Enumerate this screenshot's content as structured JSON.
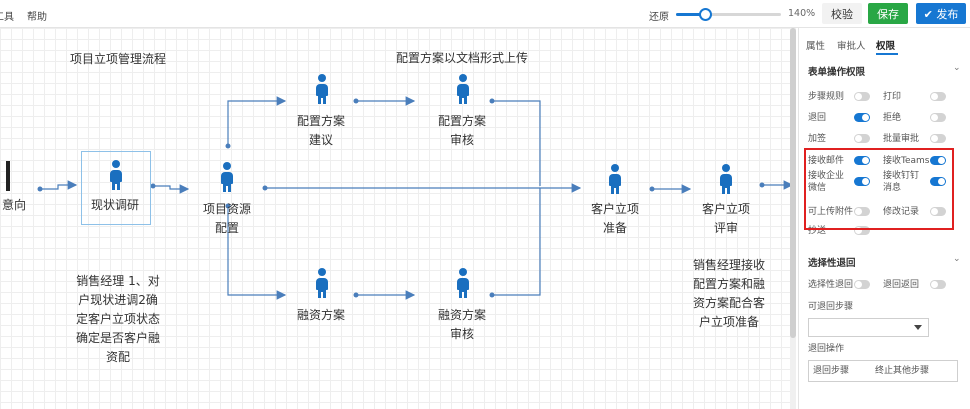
{
  "toolbar": {
    "menu_tools": "工具",
    "menu_help": "帮助",
    "zoom_reset": "还原",
    "zoom_value": "140%",
    "zoom_fraction": 0.28,
    "validate_label": "校验",
    "save_label": "保存",
    "publish_label": "发布",
    "publish_icon": "check-icon"
  },
  "canvas": {
    "title_left": "项目立项管理流程",
    "title_right": "配置方案以文档形式上传",
    "nodes": {
      "left_cut": "意向",
      "research": "现状调研",
      "resource": "项目资源\n配置",
      "config_proposal": "配置方案\n建议",
      "config_review": "配置方案\n审核",
      "finance_plan": "融资方案",
      "finance_review": "融资方案\n审核",
      "prep": "客户立项\n准备",
      "review": "客户立项\n评审"
    },
    "note_left": "销售经理 1、对\n户现状进调2确\n定客户立项状态\n确定是否客户融\n资配",
    "note_right": "销售经理接收\n配置方案和融\n资方案配合客\n户立项准备",
    "colors": {
      "line": "#4a7ebb",
      "person": "#1a6fbf"
    }
  },
  "panel": {
    "tabs": [
      "属性",
      "审批人",
      "权限"
    ],
    "active_tab": "权限",
    "section_form": "表单操作权限",
    "toggles": [
      {
        "label": "步骤规则",
        "on": false
      },
      {
        "label": "打印",
        "on": false
      },
      {
        "label": "退回",
        "on": true
      },
      {
        "label": "拒绝",
        "on": false
      },
      {
        "label": "加签",
        "on": false
      },
      {
        "label": "批量审批",
        "on": false
      },
      {
        "label": "接收邮件",
        "on": true
      },
      {
        "label": "接收Teams",
        "on": true
      },
      {
        "label": "接收企业微信",
        "on": true
      },
      {
        "label": "接收钉钉消息",
        "on": true
      },
      {
        "label": "可上传附件",
        "on": false
      },
      {
        "label": "修改记录",
        "on": false
      },
      {
        "label": "抄送",
        "on": false
      }
    ],
    "section_return": "选择性退回",
    "return_toggles": [
      {
        "label": "选择性退回",
        "on": false
      },
      {
        "label": "退回返回",
        "on": false
      }
    ],
    "returnable_steps_label": "可退回步骤",
    "return_select_value": "",
    "return_operation_label": "退回操作",
    "return_step_text": "退回步骤",
    "terminate_text": "终止其他步骤",
    "highlight_color": "#e02020",
    "accent_color": "#1677d2"
  }
}
